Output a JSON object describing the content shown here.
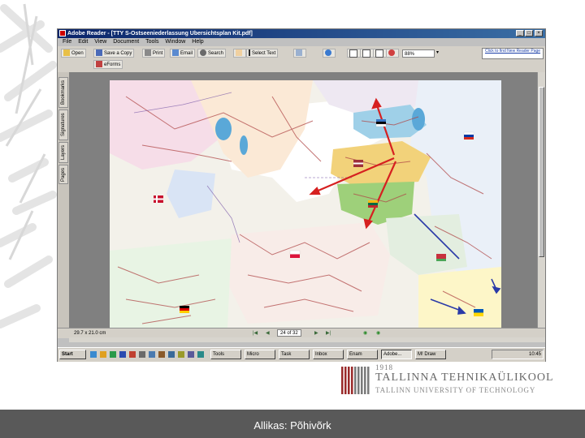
{
  "window": {
    "title": "Adobe Reader - [TTY S-Ostseeniederlassung Ubersichtsplan Kit.pdf]",
    "menu": [
      "File",
      "Edit",
      "View",
      "Document",
      "Tools",
      "Window",
      "Help"
    ],
    "controls": [
      "_",
      "□",
      "×"
    ]
  },
  "toolbar": {
    "open_label": "Open",
    "save_label": "Save a Copy",
    "print_label": "Print",
    "email_label": "Email",
    "search_label": "Search",
    "select_label": "Select Text",
    "zoom_value": "88%",
    "efforts_label": "eForms",
    "ad_text": "Click to find New Reader Page"
  },
  "side_tabs": [
    "Bookmarks",
    "Signatures",
    "Layers",
    "Pages"
  ],
  "status": {
    "page_size": "29.7 x 21.0 cm",
    "page_indicator": "24 of 32"
  },
  "taskbar": {
    "start_label": "Start",
    "tasks": [
      "Tools",
      "Micro",
      "Task",
      "Inbox",
      "Enam",
      "Adobe...",
      "M! Draw"
    ],
    "active_task_index": 5,
    "clock": "10:45"
  },
  "logo": {
    "year": "1918",
    "name_et": "TALLINNA TEHNIKAÜLIKOOL",
    "name_en": "TALLINN UNIVERSITY OF TECHNOLOGY"
  },
  "caption": "Allikas: Põhivõrk",
  "colors": {
    "footer_bg": "#595959",
    "map_arrow": "#d62020",
    "estonia": "#9fd0e8",
    "latvia": "#f2d27a",
    "lithuania": "#9ed07a",
    "logo_gray": "#7a7a7a"
  }
}
